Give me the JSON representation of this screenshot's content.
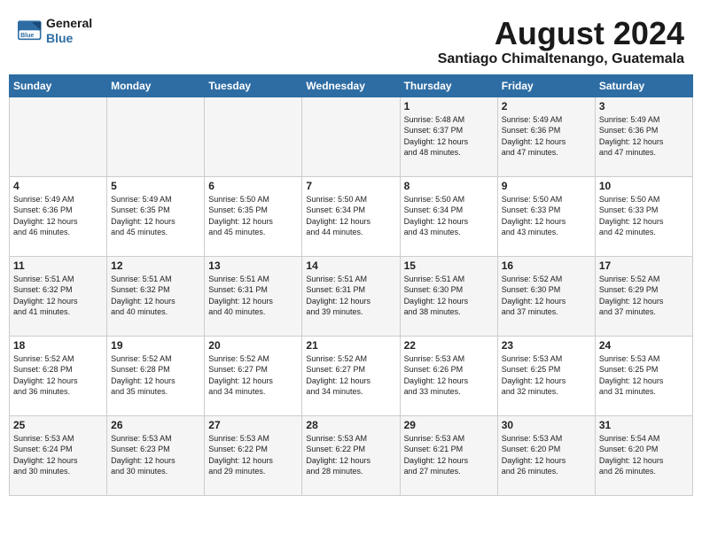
{
  "header": {
    "logo_line1": "General",
    "logo_line2": "Blue",
    "month": "August 2024",
    "location": "Santiago Chimaltenango, Guatemala"
  },
  "weekdays": [
    "Sunday",
    "Monday",
    "Tuesday",
    "Wednesday",
    "Thursday",
    "Friday",
    "Saturday"
  ],
  "weeks": [
    [
      {
        "day": "",
        "text": ""
      },
      {
        "day": "",
        "text": ""
      },
      {
        "day": "",
        "text": ""
      },
      {
        "day": "",
        "text": ""
      },
      {
        "day": "1",
        "text": "Sunrise: 5:48 AM\nSunset: 6:37 PM\nDaylight: 12 hours\nand 48 minutes."
      },
      {
        "day": "2",
        "text": "Sunrise: 5:49 AM\nSunset: 6:36 PM\nDaylight: 12 hours\nand 47 minutes."
      },
      {
        "day": "3",
        "text": "Sunrise: 5:49 AM\nSunset: 6:36 PM\nDaylight: 12 hours\nand 47 minutes."
      }
    ],
    [
      {
        "day": "4",
        "text": "Sunrise: 5:49 AM\nSunset: 6:36 PM\nDaylight: 12 hours\nand 46 minutes."
      },
      {
        "day": "5",
        "text": "Sunrise: 5:49 AM\nSunset: 6:35 PM\nDaylight: 12 hours\nand 45 minutes."
      },
      {
        "day": "6",
        "text": "Sunrise: 5:50 AM\nSunset: 6:35 PM\nDaylight: 12 hours\nand 45 minutes."
      },
      {
        "day": "7",
        "text": "Sunrise: 5:50 AM\nSunset: 6:34 PM\nDaylight: 12 hours\nand 44 minutes."
      },
      {
        "day": "8",
        "text": "Sunrise: 5:50 AM\nSunset: 6:34 PM\nDaylight: 12 hours\nand 43 minutes."
      },
      {
        "day": "9",
        "text": "Sunrise: 5:50 AM\nSunset: 6:33 PM\nDaylight: 12 hours\nand 43 minutes."
      },
      {
        "day": "10",
        "text": "Sunrise: 5:50 AM\nSunset: 6:33 PM\nDaylight: 12 hours\nand 42 minutes."
      }
    ],
    [
      {
        "day": "11",
        "text": "Sunrise: 5:51 AM\nSunset: 6:32 PM\nDaylight: 12 hours\nand 41 minutes."
      },
      {
        "day": "12",
        "text": "Sunrise: 5:51 AM\nSunset: 6:32 PM\nDaylight: 12 hours\nand 40 minutes."
      },
      {
        "day": "13",
        "text": "Sunrise: 5:51 AM\nSunset: 6:31 PM\nDaylight: 12 hours\nand 40 minutes."
      },
      {
        "day": "14",
        "text": "Sunrise: 5:51 AM\nSunset: 6:31 PM\nDaylight: 12 hours\nand 39 minutes."
      },
      {
        "day": "15",
        "text": "Sunrise: 5:51 AM\nSunset: 6:30 PM\nDaylight: 12 hours\nand 38 minutes."
      },
      {
        "day": "16",
        "text": "Sunrise: 5:52 AM\nSunset: 6:30 PM\nDaylight: 12 hours\nand 37 minutes."
      },
      {
        "day": "17",
        "text": "Sunrise: 5:52 AM\nSunset: 6:29 PM\nDaylight: 12 hours\nand 37 minutes."
      }
    ],
    [
      {
        "day": "18",
        "text": "Sunrise: 5:52 AM\nSunset: 6:28 PM\nDaylight: 12 hours\nand 36 minutes."
      },
      {
        "day": "19",
        "text": "Sunrise: 5:52 AM\nSunset: 6:28 PM\nDaylight: 12 hours\nand 35 minutes."
      },
      {
        "day": "20",
        "text": "Sunrise: 5:52 AM\nSunset: 6:27 PM\nDaylight: 12 hours\nand 34 minutes."
      },
      {
        "day": "21",
        "text": "Sunrise: 5:52 AM\nSunset: 6:27 PM\nDaylight: 12 hours\nand 34 minutes."
      },
      {
        "day": "22",
        "text": "Sunrise: 5:53 AM\nSunset: 6:26 PM\nDaylight: 12 hours\nand 33 minutes."
      },
      {
        "day": "23",
        "text": "Sunrise: 5:53 AM\nSunset: 6:25 PM\nDaylight: 12 hours\nand 32 minutes."
      },
      {
        "day": "24",
        "text": "Sunrise: 5:53 AM\nSunset: 6:25 PM\nDaylight: 12 hours\nand 31 minutes."
      }
    ],
    [
      {
        "day": "25",
        "text": "Sunrise: 5:53 AM\nSunset: 6:24 PM\nDaylight: 12 hours\nand 30 minutes."
      },
      {
        "day": "26",
        "text": "Sunrise: 5:53 AM\nSunset: 6:23 PM\nDaylight: 12 hours\nand 30 minutes."
      },
      {
        "day": "27",
        "text": "Sunrise: 5:53 AM\nSunset: 6:22 PM\nDaylight: 12 hours\nand 29 minutes."
      },
      {
        "day": "28",
        "text": "Sunrise: 5:53 AM\nSunset: 6:22 PM\nDaylight: 12 hours\nand 28 minutes."
      },
      {
        "day": "29",
        "text": "Sunrise: 5:53 AM\nSunset: 6:21 PM\nDaylight: 12 hours\nand 27 minutes."
      },
      {
        "day": "30",
        "text": "Sunrise: 5:53 AM\nSunset: 6:20 PM\nDaylight: 12 hours\nand 26 minutes."
      },
      {
        "day": "31",
        "text": "Sunrise: 5:54 AM\nSunset: 6:20 PM\nDaylight: 12 hours\nand 26 minutes."
      }
    ]
  ]
}
